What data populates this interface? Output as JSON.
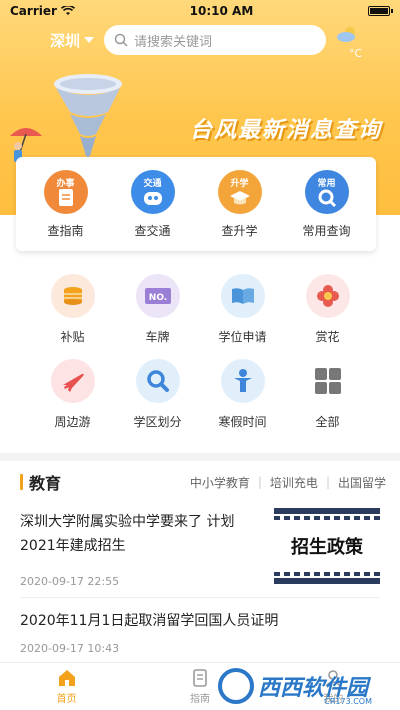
{
  "status": {
    "carrier": "Carrier",
    "time": "10:10 AM"
  },
  "header": {
    "city": "深圳",
    "search_placeholder": "请搜索关键词",
    "weather_unit": "°C",
    "banner_title": "台风最新消息查询"
  },
  "quick": [
    {
      "label": "查指南",
      "tag": "办事",
      "color": "#f08a3a",
      "icon": "document-icon"
    },
    {
      "label": "查交通",
      "tag": "交通",
      "color": "#3d8ce8",
      "icon": "robot-icon"
    },
    {
      "label": "查升学",
      "tag": "升学",
      "color": "#f3a53a",
      "icon": "graduation-cap-icon"
    },
    {
      "label": "常用查询",
      "tag": "常用",
      "color": "#3f86e0",
      "icon": "magnifier-icon"
    }
  ],
  "grid": [
    {
      "label": "补贴",
      "icon": "coins-icon",
      "bg": "#fde8dc",
      "fg": "#f2a21b"
    },
    {
      "label": "车牌",
      "icon": "license-plate-icon",
      "bg": "#ece4f7",
      "fg": "#9b7fd6"
    },
    {
      "label": "学位申请",
      "icon": "book-icon",
      "bg": "#e1effb",
      "fg": "#4a95d9"
    },
    {
      "label": "赏花",
      "icon": "flower-icon",
      "bg": "#fde6e6",
      "fg": "#e85a4f"
    },
    {
      "label": "周边游",
      "icon": "airplane-icon",
      "bg": "#fde3e3",
      "fg": "#e8504f"
    },
    {
      "label": "学区划分",
      "icon": "search-icon",
      "bg": "#e1effb",
      "fg": "#3e86d9"
    },
    {
      "label": "寒假时间",
      "icon": "person-icon",
      "bg": "#e1effb",
      "fg": "#3e86d9"
    },
    {
      "label": "全部",
      "icon": "grid-icon",
      "bg": "#ffffff",
      "fg": "#777777"
    }
  ],
  "section": {
    "title": "教育",
    "tabs": [
      "中小学教育",
      "培训充电",
      "出国留学"
    ]
  },
  "news": [
    {
      "title": "深圳大学附属实验中学要来了 计划2021年建成招生",
      "time": "2020-09-17 22:55",
      "thumb_text": "招生政策"
    },
    {
      "title": "2020年11月1日起取消留学回国人员证明",
      "time": "2020-09-17 10:43"
    }
  ],
  "tabbar": [
    {
      "label": "首页",
      "icon": "home-icon"
    },
    {
      "label": "指南",
      "icon": "guide-icon"
    },
    {
      "label": "我的",
      "icon": "profile-icon"
    }
  ],
  "watermark": {
    "text": "西西软件园",
    "sub": "CR173.COM"
  }
}
